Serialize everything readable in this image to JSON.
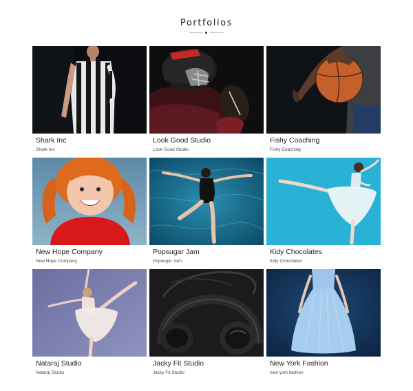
{
  "page": {
    "title": "Portfolios"
  },
  "portfolios": [
    {
      "title": "Shark Inc",
      "subtitle": "Shark Inc"
    },
    {
      "title": "Look Good Studio",
      "subtitle": "Look Good Studio"
    },
    {
      "title": "Fishy Coaching",
      "subtitle": "Fishy Coaching"
    },
    {
      "title": "New Hope Company",
      "subtitle": "New Hope Company"
    },
    {
      "title": "Popsugar Jam",
      "subtitle": "Popsugar Jam"
    },
    {
      "title": "Kidy Chocolates",
      "subtitle": "Kidy Chocolates"
    },
    {
      "title": "Nataraj Studio",
      "subtitle": "Nataraj Studio"
    },
    {
      "title": "Jacky Fit Studio",
      "subtitle": "Jacky Fit Studio"
    },
    {
      "title": "New York Fashion",
      "subtitle": "new york fashion"
    }
  ]
}
